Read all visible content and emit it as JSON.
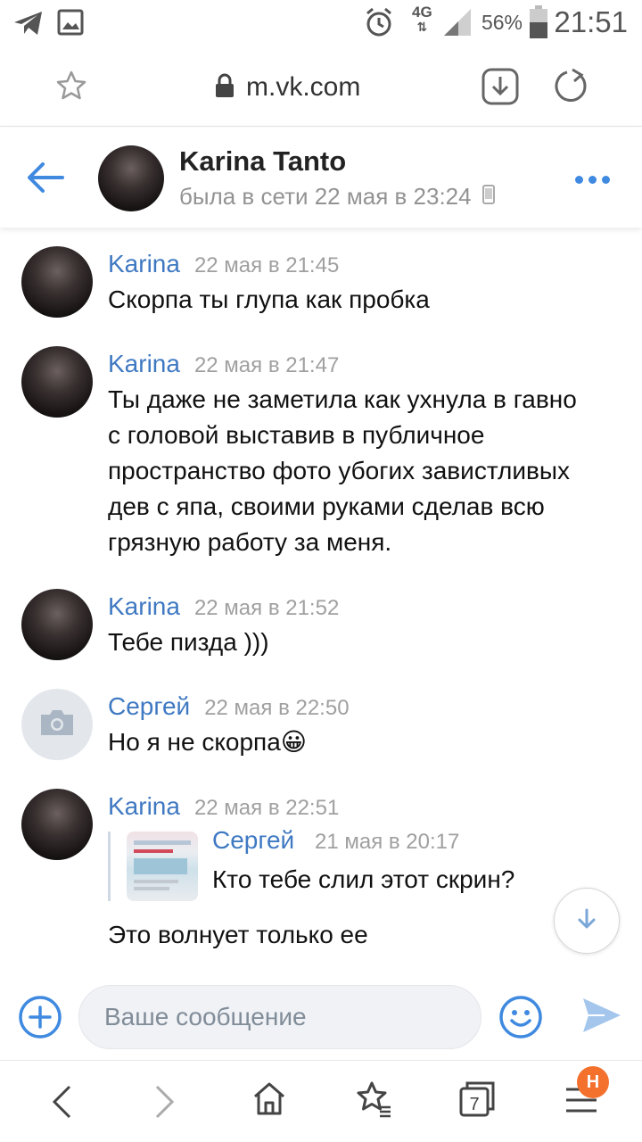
{
  "status_bar": {
    "network": "4G",
    "battery": "56%",
    "time": "21:51"
  },
  "browser": {
    "url": "m.vk.com"
  },
  "chat": {
    "name": "Karina Tanto",
    "status": "была в сети 22 мая в 23:24"
  },
  "messages": [
    {
      "author": "Karina",
      "time": "22 мая в 21:45",
      "text": "Скорпа ты глупа как пробка"
    },
    {
      "author": "Karina",
      "time": "22 мая в 21:47",
      "lines": [
        "Ты даже не заметила как ухнула в гавно",
        "с головой выставив в публичное",
        "пространство фото убогих завистливых",
        "дев с япа, своими руками сделав всю",
        "грязную работу за меня."
      ]
    },
    {
      "author": "Karina",
      "time": "22 мая в 21:52",
      "text": "Тебе пизда )))"
    },
    {
      "author": "Сергей",
      "time": "22 мая в 22:50",
      "text": "Но я не скорпа",
      "emoji": "😀"
    },
    {
      "author": "Karina",
      "time": "22 мая в 22:51",
      "text": "Это волнует только ее",
      "reply": {
        "author": "Сергей",
        "time": "21 мая в 20:17",
        "text": "Кто тебе слил этот скрин?"
      }
    }
  ],
  "composer": {
    "placeholder": "Ваше сообщение"
  },
  "bottom_nav": {
    "tabs_count": "7",
    "badge": "H"
  },
  "colors": {
    "accent": "#3f8ae0",
    "author": "#3f79c2",
    "badge": "#f4702d"
  }
}
